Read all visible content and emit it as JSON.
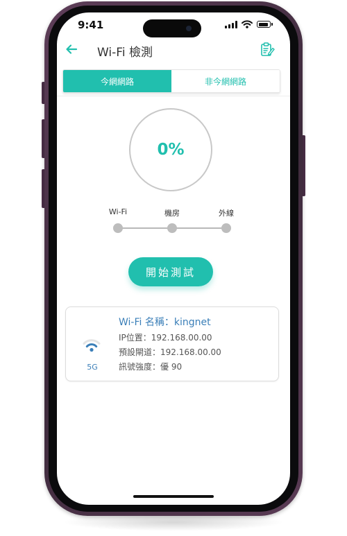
{
  "status_bar": {
    "time": "9:41"
  },
  "header": {
    "title": "Wi-Fi 檢測",
    "back_icon": "arrow-left-icon",
    "report_icon": "clipboard-edit-icon"
  },
  "tabs": [
    {
      "label": "今網網路",
      "active": true
    },
    {
      "label": "非今網網路",
      "active": false
    }
  ],
  "progress": {
    "value_text": "0%",
    "value": 0
  },
  "steps": [
    {
      "label": "Wi-Fi"
    },
    {
      "label": "機房"
    },
    {
      "label": "外線"
    }
  ],
  "start_button": {
    "label": "開始測試"
  },
  "wifi_info": {
    "name": "Wi-Fi 名稱：kingnet",
    "ip": "IP位置：192.168.00.00",
    "gateway": "預設閘道：192.168.00.00",
    "signal": "訊號強度：優 90",
    "band": "5G",
    "icon": "wifi-icon"
  },
  "colors": {
    "accent": "#21bfae",
    "link_blue": "#3b7fb8",
    "phone_frame": "#4a3047"
  }
}
